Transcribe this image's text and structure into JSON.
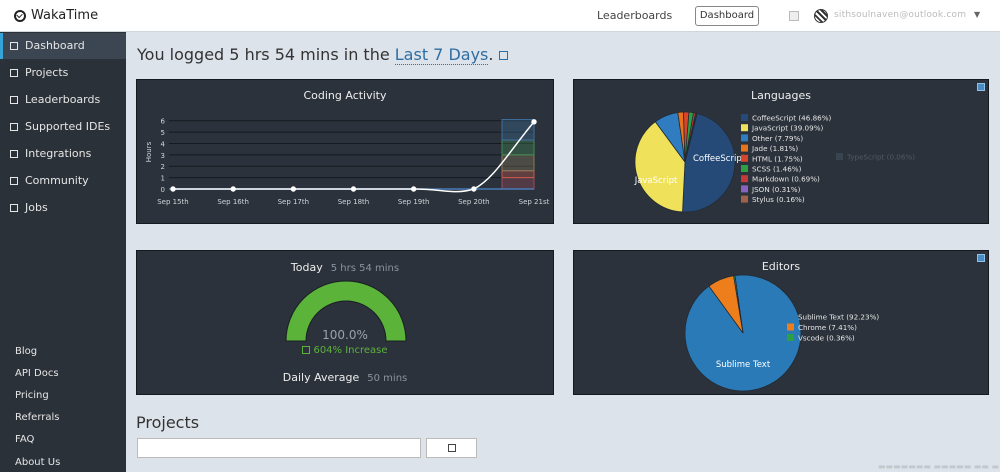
{
  "header": {
    "app_name": "WakaTime",
    "nav_leaderboards": "Leaderboards",
    "nav_dashboard": "Dashboard",
    "user_email": "sithsoulnaven@outlook.com"
  },
  "sidebar": {
    "items": [
      {
        "label": "Dashboard",
        "active": true
      },
      {
        "label": "Projects"
      },
      {
        "label": "Leaderboards"
      },
      {
        "label": "Supported IDEs"
      },
      {
        "label": "Integrations"
      },
      {
        "label": "Community"
      },
      {
        "label": "Jobs"
      }
    ],
    "footer": [
      "Blog",
      "API Docs",
      "Pricing",
      "Referrals",
      "FAQ",
      "About Us"
    ]
  },
  "headline": {
    "prefix": "You logged 5 hrs 54 mins in the ",
    "range_link": "Last 7 Days",
    "suffix": "."
  },
  "coding_activity": {
    "title": "Coding Activity",
    "chart_data": {
      "type": "line",
      "title": "Coding Activity",
      "ylabel": "Hours",
      "xlabel": "",
      "categories": [
        "Sep 15th",
        "Sep 16th",
        "Sep 17th",
        "Sep 18th",
        "Sep 19th",
        "Sep 20th",
        "Sep 21st"
      ],
      "values": [
        0,
        0,
        0,
        0,
        0,
        0,
        5.9
      ],
      "yticks": [
        0,
        1,
        2,
        3,
        4,
        5,
        6
      ],
      "ylim": [
        0,
        6.5
      ],
      "grid": true,
      "stacked_bar_on_last_day": [
        {
          "value": 1.0,
          "color": "#9c4a5f"
        },
        {
          "value": 0.6,
          "color": "#c65a4a"
        },
        {
          "value": 1.4,
          "color": "#8a7a5a"
        },
        {
          "value": 1.3,
          "color": "#3f8c52"
        },
        {
          "value": 1.8,
          "color": "#3d6f9c"
        }
      ]
    }
  },
  "languages": {
    "title": "Languages",
    "legend_extra": "TypeScript (0.06%)",
    "chart_data": {
      "type": "pie",
      "title": "Languages",
      "slices": [
        {
          "label": "CoffeeScript (46.86%)",
          "name": "CoffeeScript",
          "value": 46.86,
          "color": "#254a78"
        },
        {
          "label": "JavaScript (39.09%)",
          "name": "JavaScript",
          "value": 39.09,
          "color": "#efe15a"
        },
        {
          "label": "Other (7.79%)",
          "name": "Other",
          "value": 7.79,
          "color": "#2f7dc0"
        },
        {
          "label": "Jade (1.81%)",
          "name": "Jade",
          "value": 1.81,
          "color": "#e8731a"
        },
        {
          "label": "HTML (1.75%)",
          "name": "HTML",
          "value": 1.75,
          "color": "#d8452a"
        },
        {
          "label": "SCSS (1.46%)",
          "name": "SCSS",
          "value": 1.46,
          "color": "#2ea044"
        },
        {
          "label": "Markdown (0.69%)",
          "name": "Markdown",
          "value": 0.69,
          "color": "#c23a3a"
        },
        {
          "label": "JSON (0.31%)",
          "name": "JSON",
          "value": 0.31,
          "color": "#8a63c2"
        },
        {
          "label": "Stylus (0.16%)",
          "name": "Stylus",
          "value": 0.16,
          "color": "#a0624a"
        }
      ],
      "pie_labels": [
        "CoffeeScript",
        "JavaScript"
      ],
      "legend": "right"
    }
  },
  "today": {
    "label": "Today",
    "value": "5 hrs 54 mins",
    "percent": "100.0%",
    "gauge_fraction": 1.0,
    "increase": "604% Increase",
    "avg_label": "Daily Average",
    "avg_value": "50 mins"
  },
  "editors": {
    "title": "Editors",
    "chart_data": {
      "type": "pie",
      "title": "Editors",
      "slices": [
        {
          "label": "Sublime Text (92.23%)",
          "name": "Sublime Text",
          "value": 92.23,
          "color": "#2a7ab8"
        },
        {
          "label": "Chrome (7.41%)",
          "name": "Chrome",
          "value": 7.41,
          "color": "#ee7d1c"
        },
        {
          "label": "Vscode (0.36%)",
          "name": "Vscode",
          "value": 0.36,
          "color": "#2ea044"
        }
      ],
      "pie_labels": [
        "Sublime Text"
      ],
      "legend": "right"
    }
  },
  "projects": {
    "title": "Projects",
    "search_placeholder": ""
  },
  "colors": {
    "accent": "#36a3d9",
    "panel_bg": "#2b323b",
    "sidebar_bg": "#2b3138",
    "gauge_green": "#5bb33a"
  }
}
